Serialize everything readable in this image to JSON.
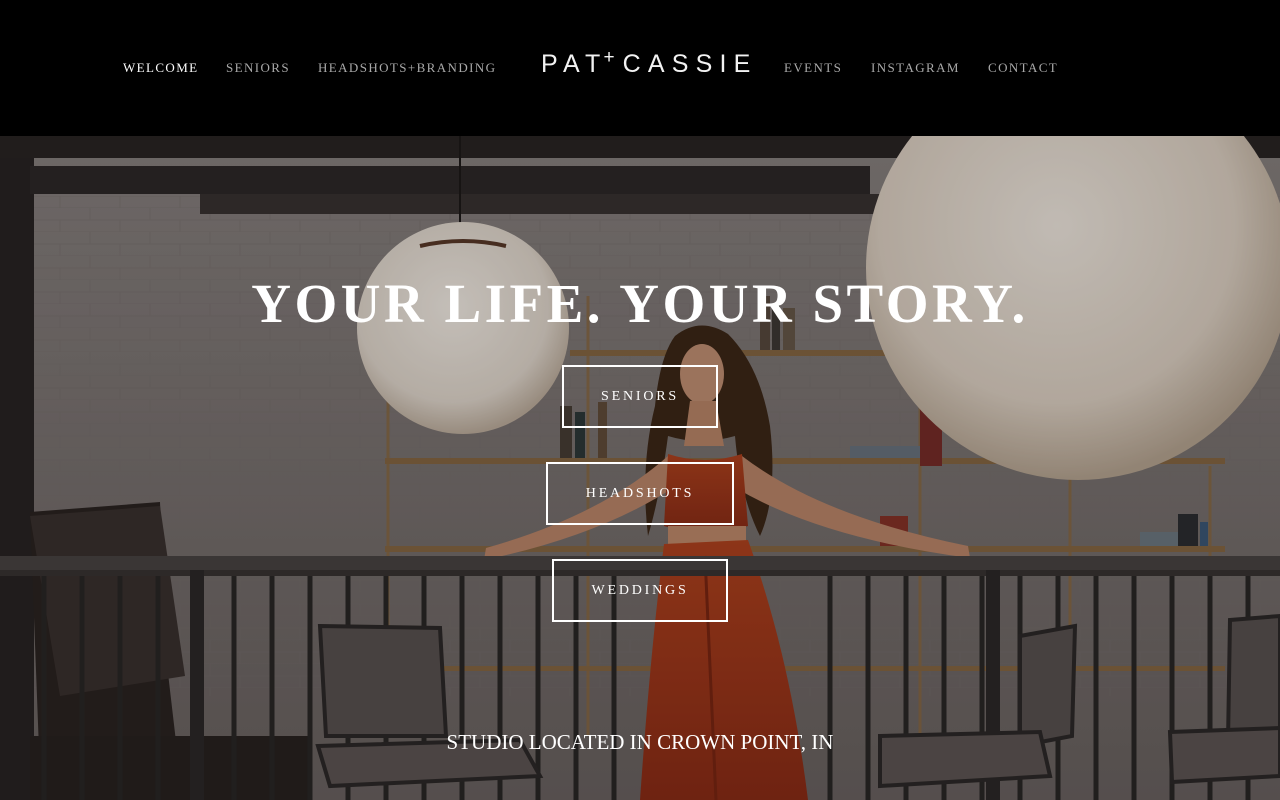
{
  "nav": {
    "left": [
      "WELCOME",
      "SENIORS",
      "HEADSHOTS+BRANDING"
    ],
    "right": [
      "EVENTS",
      "INSTAGRAM",
      "CONTACT"
    ],
    "active": "WELCOME"
  },
  "logo": {
    "left": "PAT",
    "plus": "+",
    "right": "CASSIE"
  },
  "hero": {
    "title": "YOUR LIFE. YOUR STORY.",
    "buttons": [
      "SENIORS",
      "HEADSHOTS",
      "WEDDINGS"
    ],
    "location": "STUDIO LOCATED IN CROWN POINT, IN"
  },
  "colors": {
    "header_bg": "#000000",
    "nav_text": "#a9a9a9",
    "nav_active": "#ffffff",
    "dress": "#b03a1e"
  }
}
